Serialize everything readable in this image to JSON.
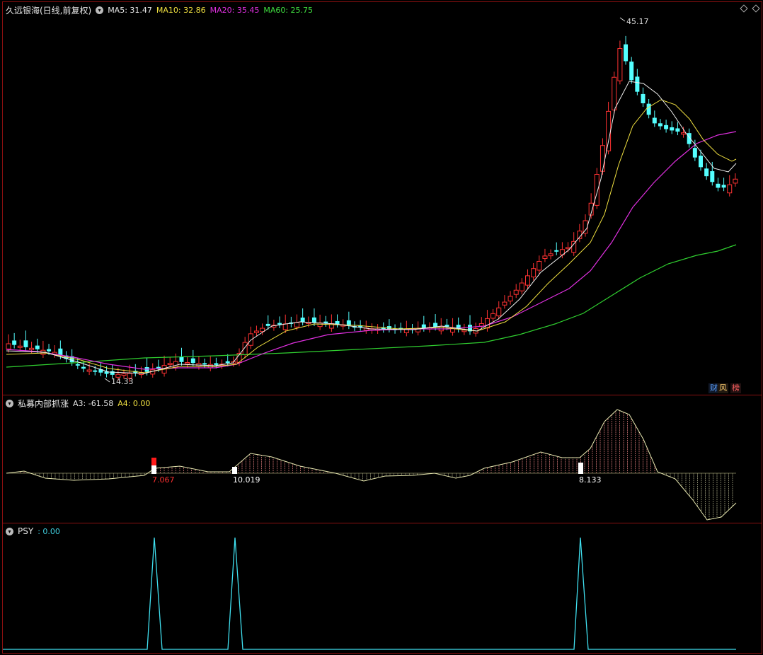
{
  "main": {
    "title": "久远银海(日线,前复权)",
    "ma": [
      {
        "label": "MA5: 31.47",
        "color": "#e8e8e8"
      },
      {
        "label": "MA10: 32.86",
        "color": "#f0e040"
      },
      {
        "label": "MA20: 35.45",
        "color": "#e030e0"
      },
      {
        "label": "MA60: 25.75",
        "color": "#40e040"
      }
    ],
    "high_label": "45.17",
    "low_label": "14.33",
    "badges": {
      "finance": "财",
      "risk": "风",
      "rank": "榜"
    }
  },
  "indicator": {
    "title": "私募内部抓涨",
    "a3": "A3: -61.58",
    "a4": "A4: 0.00",
    "labels": [
      "7.067",
      "10.019",
      "8.133"
    ]
  },
  "psy": {
    "title": "PSY",
    "value": ": 0.00"
  },
  "colors": {
    "up": "#ff3232",
    "down": "#54ffff",
    "border": "#8a1010"
  }
}
